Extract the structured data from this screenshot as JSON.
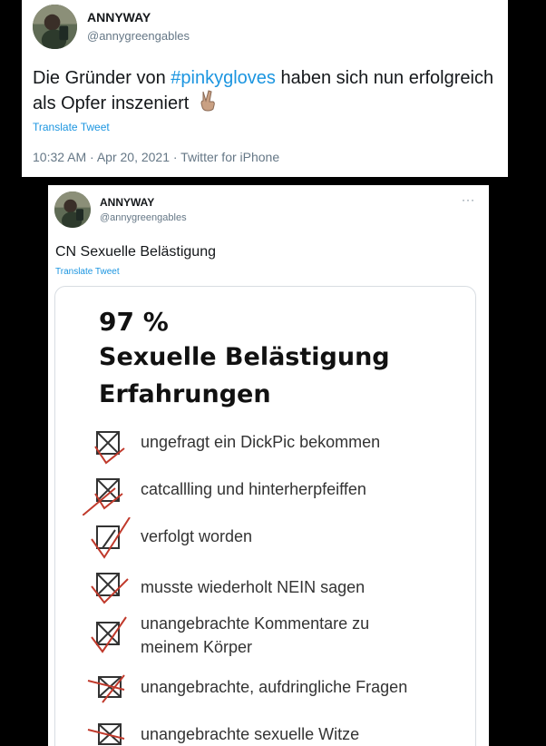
{
  "tweet1": {
    "name": "ANNYWAY",
    "handle": "@annygreengables",
    "text_before": "Die Gründer von ",
    "hashtag": "#pinkygloves",
    "text_after": " haben sich nun erfolgreich als Opfer inszeniert",
    "emoji_icon": "victory-hand-icon",
    "translate": "Translate Tweet",
    "meta": "10:32 AM · Apr 20, 2021 · Twitter for iPhone"
  },
  "tweet2": {
    "name": "ANNYWAY",
    "handle": "@annygreengables",
    "more": "···",
    "text": "CN Sexuelle Belästigung",
    "translate": "Translate Tweet",
    "image": {
      "percent": "97 %",
      "title_line1": "Sexuelle Belästigung",
      "title_line2": "Erfahrungen",
      "items": [
        {
          "label_line1": "ungefragt ein DickPic bekommen",
          "label_line2": ""
        },
        {
          "label_line1": "catcallling und hinterherpfeiffen",
          "label_line2": ""
        },
        {
          "label_line1": "verfolgt worden",
          "label_line2": ""
        },
        {
          "label_line1": "musste wiederholt NEIN sagen",
          "label_line2": ""
        },
        {
          "label_line1": "unangebrachte Kommentare zu",
          "label_line2": "meinem Körper"
        },
        {
          "label_line1": "unangebrachte, aufdringliche Fragen",
          "label_line2": ""
        },
        {
          "label_line1": "unangebrachte sexuelle Witze",
          "label_line2": ""
        }
      ]
    }
  },
  "colors": {
    "link": "#1b95e0",
    "check_red": "#c0392b",
    "box_dark": "#333333"
  }
}
